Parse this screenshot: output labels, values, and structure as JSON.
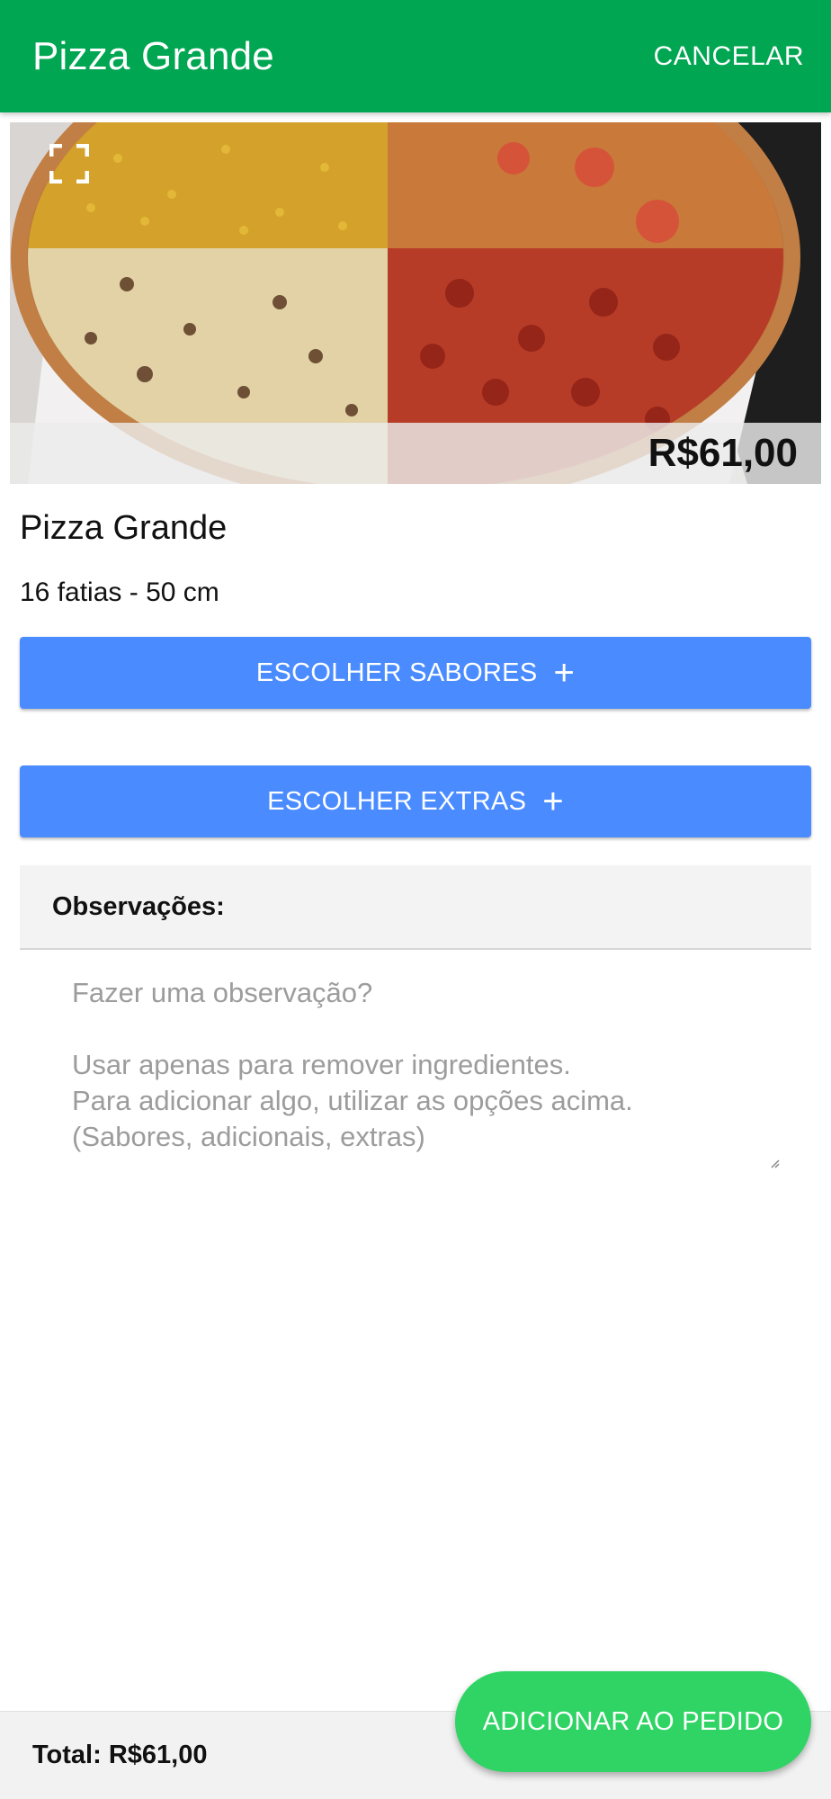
{
  "header": {
    "title": "Pizza Grande",
    "cancel_label": "CANCELAR"
  },
  "product": {
    "image_alt": "pizza-photo",
    "price": "R$61,00",
    "name": "Pizza Grande",
    "description": "16 fatias - 50 cm"
  },
  "actions": {
    "flavors_label": "ESCOLHER SABORES",
    "extras_label": "ESCOLHER EXTRAS",
    "plus_glyph": "+"
  },
  "observations": {
    "label": "Observações:",
    "placeholder": "Fazer uma observação?\n\nUsar apenas para remover ingredientes.\nPara adicionar algo, utilizar as opções acima.\n(Sabores, adicionais, extras)",
    "value": ""
  },
  "footer": {
    "total_label": "Total: R$61,00",
    "add_button_label": "ADICIONAR AO PEDIDO"
  },
  "colors": {
    "appbar": "#00a651",
    "button_blue": "#4a8cff",
    "fab_green": "#2fd464"
  },
  "icons": {
    "expand": "fullscreen-icon",
    "resize": "resize-handle-icon"
  }
}
